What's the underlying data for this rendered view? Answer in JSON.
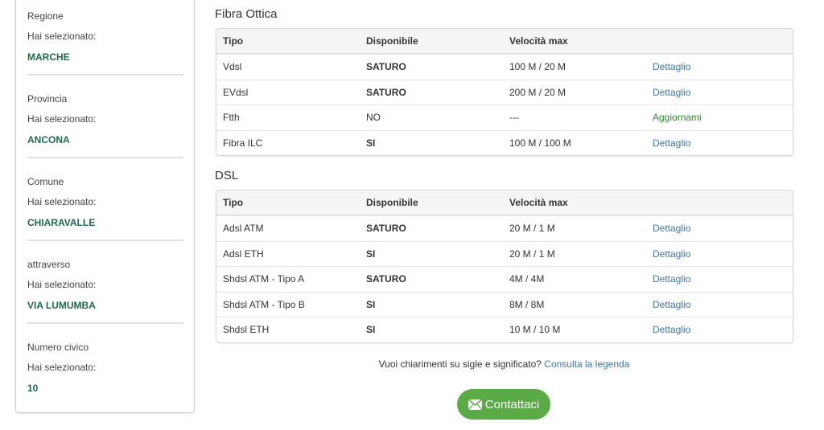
{
  "sidebar": {
    "groups": [
      {
        "label": "Regione",
        "selected_label": "Hai selezionato:",
        "value": "MARCHE"
      },
      {
        "label": "Provincia",
        "selected_label": "Hai selezionato:",
        "value": "ANCONA"
      },
      {
        "label": "Comune",
        "selected_label": "Hai selezionato:",
        "value": "CHIARAVALLE"
      },
      {
        "label": "attraverso",
        "selected_label": "Hai selezionato:",
        "value": "VIA LUMUMBA"
      },
      {
        "label": "Numero civico",
        "selected_label": "Hai selezionato:",
        "value": "10"
      }
    ]
  },
  "fibra": {
    "title": "Fibra Ottica",
    "headers": [
      "Tipo",
      "Disponibile",
      "Velocità max"
    ],
    "rows": [
      [
        "Vdsl",
        "SATURO",
        "100 M / 20 M",
        "Dettaglio"
      ],
      [
        "EVdsl",
        "SATURO",
        "200 M / 20 M",
        "Dettaglio"
      ],
      [
        "Ftth",
        "NO",
        "---",
        "Aggiornami"
      ],
      [
        "Fibra ILC",
        "SI",
        "100 M / 100 M",
        "Dettaglio"
      ]
    ]
  },
  "dsl": {
    "title": "DSL",
    "headers": [
      "Tipo",
      "Disponibile",
      "Velocità max"
    ],
    "rows": [
      [
        "Adsl ATM",
        "SATURO",
        "20 M / 1 M",
        "Dettaglio"
      ],
      [
        "Adsl ETH",
        "SI",
        "20 M / 1 M",
        "Dettaglio"
      ],
      [
        "Shdsl ATM - Tipo A",
        "SATURO",
        "4M / 4M",
        "Dettaglio"
      ],
      [
        "Shdsl ATM - Tipo B",
        "SI",
        "8M / 8M",
        "Dettaglio"
      ],
      [
        "Shdsl ETH",
        "SI",
        "10 M / 10 M",
        "Dettaglio"
      ]
    ]
  },
  "footer": {
    "question": "Vuoi chiarimenti su sigle e significato?",
    "legend_link": "Consulta la legenda",
    "contact_button": "Contattaci"
  }
}
